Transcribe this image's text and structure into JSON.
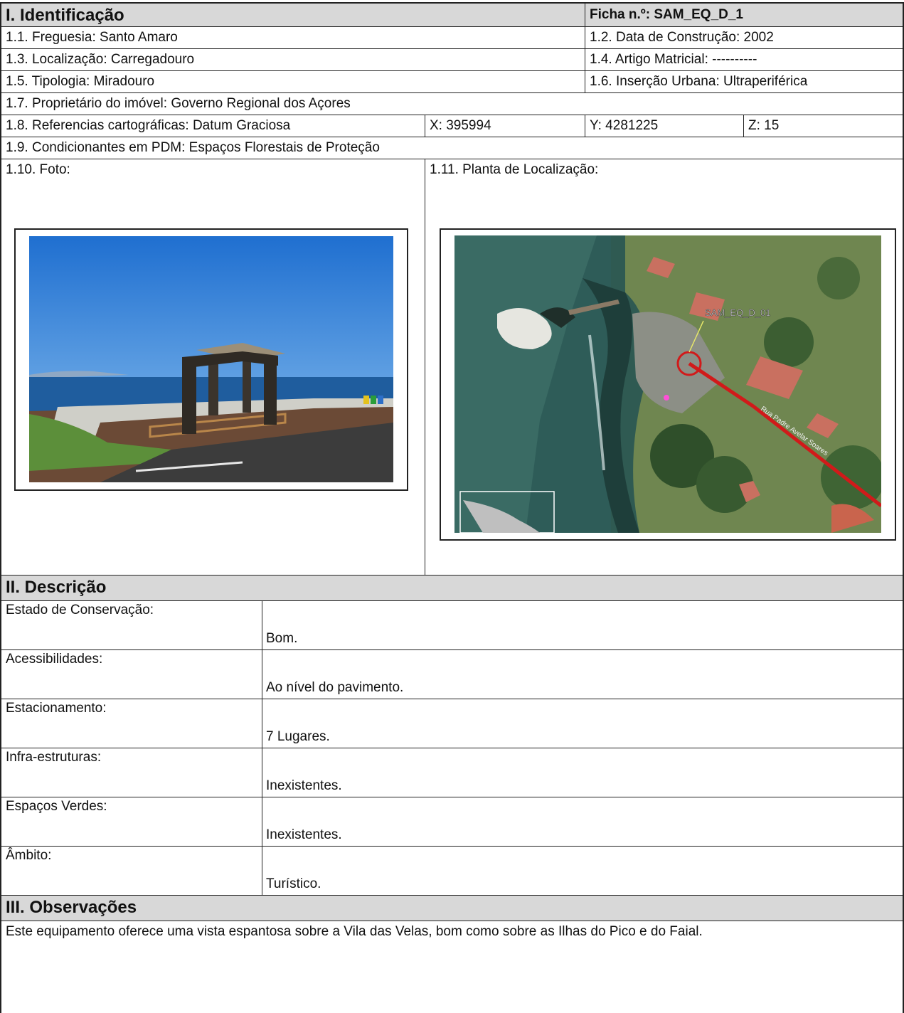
{
  "section1": {
    "title": "I. Identificação",
    "ficha": "Ficha n.º: SAM_EQ_D_1",
    "freguesia": "1.1. Freguesia: Santo Amaro",
    "data_construcao": "1.2. Data de Construção: 2002",
    "localizacao": "1.3. Localização: Carregadouro",
    "artigo_matricial": "1.4. Artigo Matricial: ----------",
    "tipologia": "1.5. Tipologia: Miradouro",
    "insercao_urbana": "1.6. Inserção Urbana: Ultraperiférica",
    "proprietario": "1.7. Proprietário do imóvel: Governo Regional dos Açores",
    "referencias": "1.8. Referencias cartográficas: Datum Graciosa",
    "x": "X: 395994",
    "y": "Y: 4281225",
    "z": "Z: 15",
    "condicionantes": "1.9. Condicionantes em PDM: Espaços Florestais de Proteção",
    "foto_label": "1.10. Foto:",
    "planta_label": "1.11. Planta de Localização:",
    "map_tag": "SAM_EQ_D_01",
    "map_street": "Rua Padre Avelar Soares"
  },
  "section2": {
    "title": "II. Descrição",
    "items": [
      {
        "label": "Estado de Conservação:",
        "value": "Bom."
      },
      {
        "label": "Acessibilidades:",
        "value": "Ao nível do pavimento."
      },
      {
        "label": "Estacionamento:",
        "value": "7 Lugares."
      },
      {
        "label": "Infra-estruturas:",
        "value": "Inexistentes."
      },
      {
        "label": "Espaços Verdes:",
        "value": "Inexistentes."
      },
      {
        "label": "Âmbito:",
        "value": "Turístico."
      }
    ]
  },
  "section3": {
    "title": "III. Observações",
    "text": "Este equipamento oferece uma vista espantosa sobre a Vila das Velas, bom como sobre as Ilhas do Pico e do Faial."
  }
}
